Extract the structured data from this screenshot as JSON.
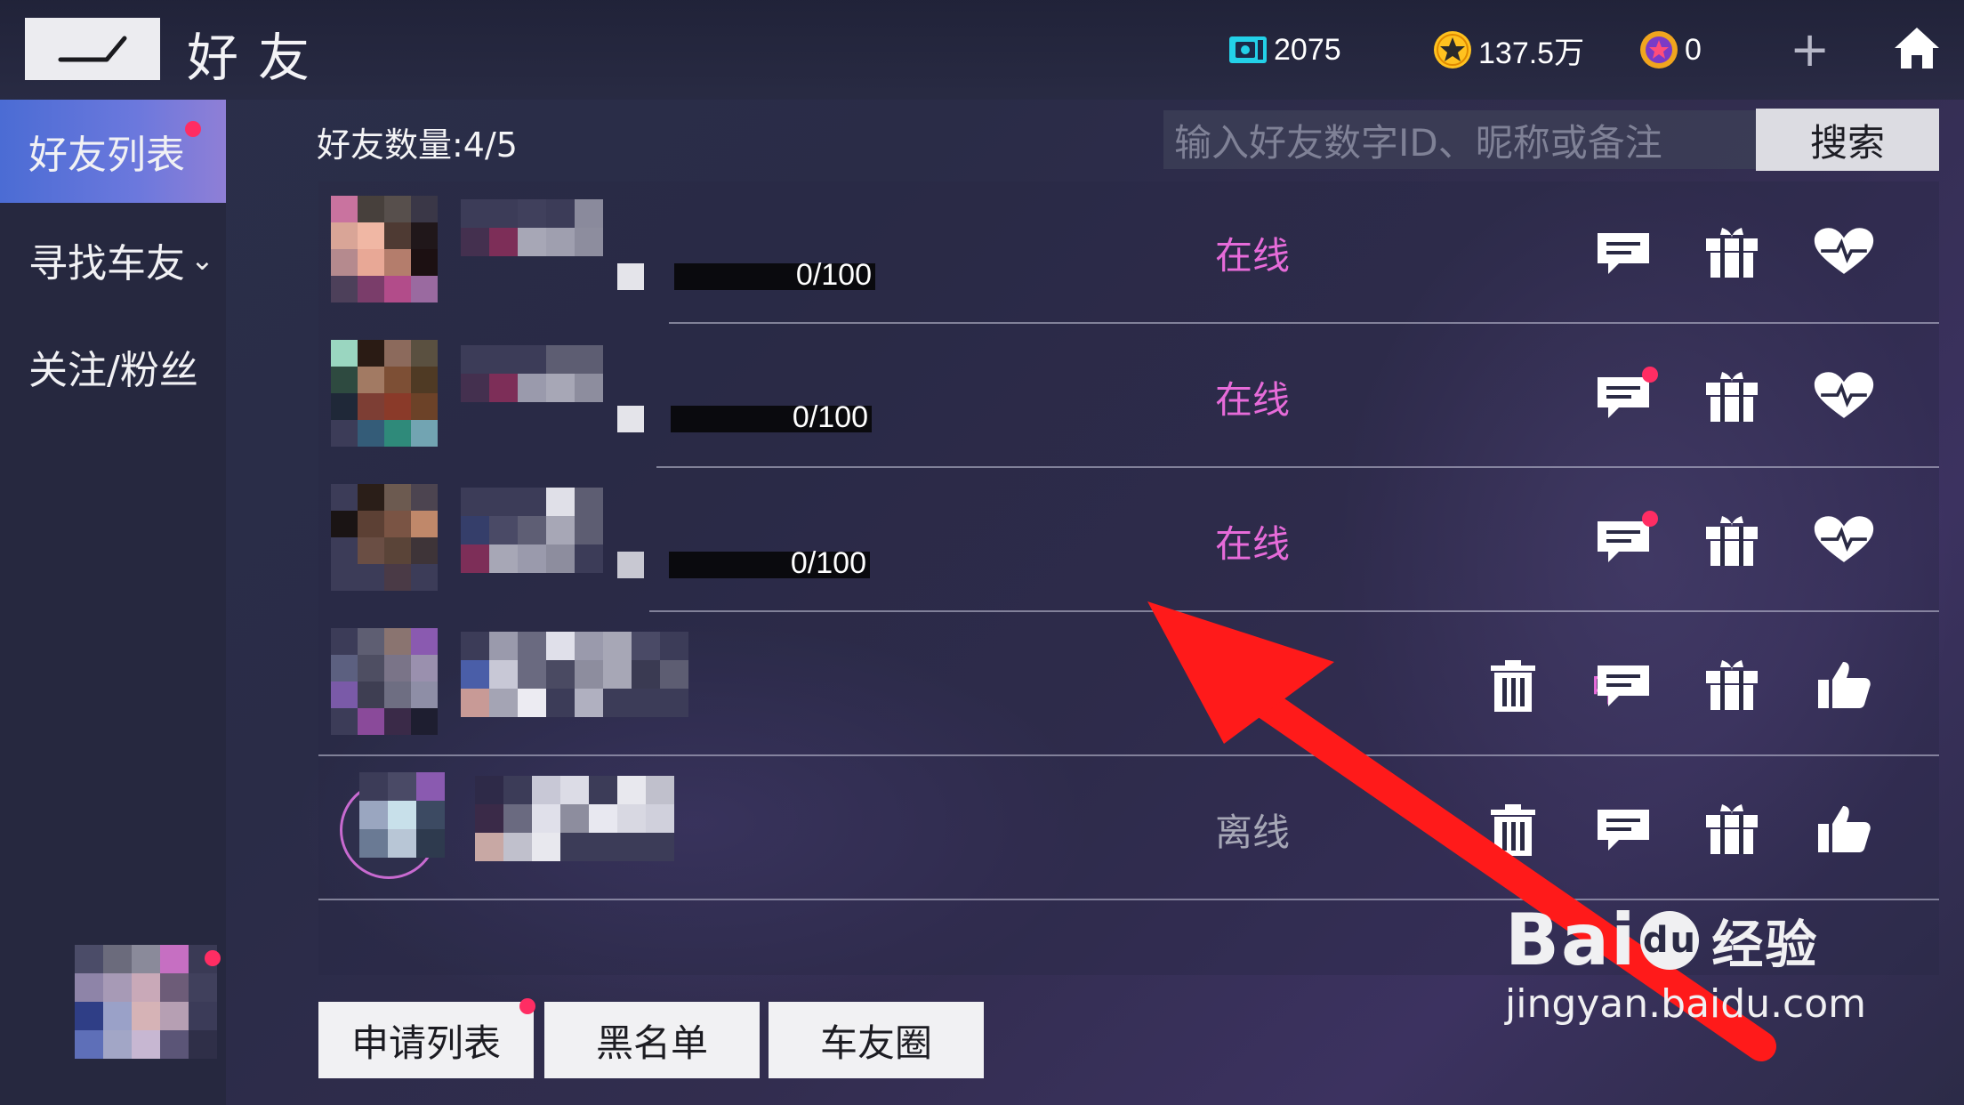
{
  "header": {
    "title": "好友",
    "currencies": [
      {
        "name": "ticket",
        "value": "2075",
        "icon": "ticket-icon"
      },
      {
        "name": "coin",
        "value": "137.5万",
        "icon": "star-coin-icon"
      },
      {
        "name": "gem",
        "value": "0",
        "icon": "purple-star-icon"
      }
    ]
  },
  "sidebar": {
    "items": [
      {
        "label": "好友列表",
        "active": true,
        "badge": true
      },
      {
        "label": "寻找车友",
        "active": false,
        "expandable": true
      },
      {
        "label": "关注/粉丝",
        "active": false
      }
    ]
  },
  "main": {
    "friend_count_label": "好友数量:4/5",
    "search_placeholder": "输入好友数字ID、昵称或备注",
    "search_button": "搜索"
  },
  "friends": [
    {
      "status": "在线",
      "progress": "0/100",
      "progress_fraction": 0.0,
      "actions": [
        "chat",
        "gift",
        "heart"
      ]
    },
    {
      "status": "在线",
      "progress": "0/100",
      "progress_fraction": 0.0,
      "actions": [
        "chat",
        "gift",
        "heart"
      ],
      "chat_badge": true
    },
    {
      "status": "在线",
      "progress": "0/100",
      "progress_fraction": 0.0,
      "actions": [
        "chat",
        "gift",
        "heart"
      ],
      "chat_badge": true
    },
    {
      "status": "中",
      "actions": [
        "delete",
        "chat",
        "gift",
        "like"
      ]
    },
    {
      "status": "离线",
      "actions": [
        "delete",
        "chat",
        "gift",
        "like"
      ]
    }
  ],
  "bottom_buttons": [
    {
      "label": "申请列表",
      "badge": true
    },
    {
      "label": "黑名单"
    },
    {
      "label": "车友圈"
    }
  ],
  "watermark": {
    "brand": "Bai",
    "du": "du",
    "cn": "经验",
    "url": "jingyan.baidu.com"
  },
  "colors": {
    "online": "#e66bd9",
    "offline": "#a6a7b6",
    "badge": "#ff2d63",
    "arrow": "#ff1a1a"
  }
}
